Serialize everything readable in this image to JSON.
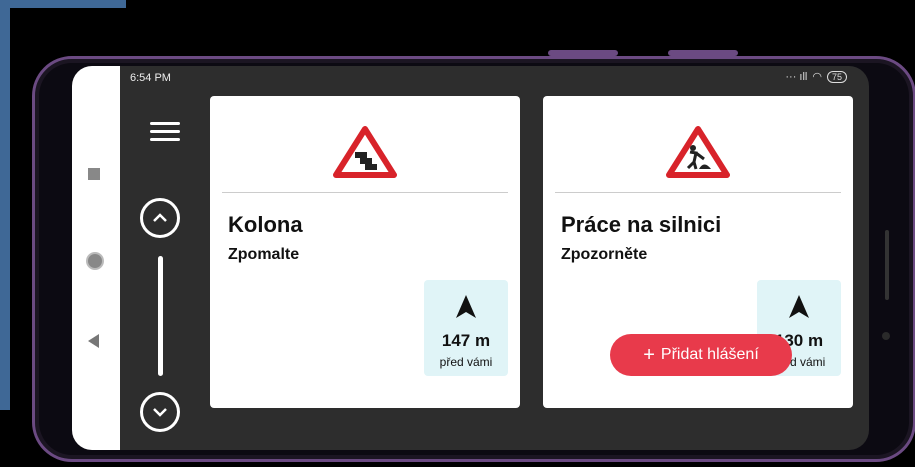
{
  "status": {
    "time": "6:54 PM",
    "battery": "75"
  },
  "cards": [
    {
      "title": "Kolona",
      "subtitle": "Zpomalte",
      "distance": "147 m",
      "distance_label": "před vámi",
      "sign_icon": "traffic-jam-warning-icon"
    },
    {
      "title": "Práce na silnici",
      "subtitle": "Zpozorněte",
      "distance": "130 m",
      "distance_label": "před vámi",
      "sign_icon": "roadworks-warning-icon"
    }
  ],
  "add_report": {
    "label": "Přidat hlášení"
  },
  "colors": {
    "accent": "#e83a4b",
    "distance_bg": "#e0f4f7",
    "sign_red": "#d8232a"
  }
}
